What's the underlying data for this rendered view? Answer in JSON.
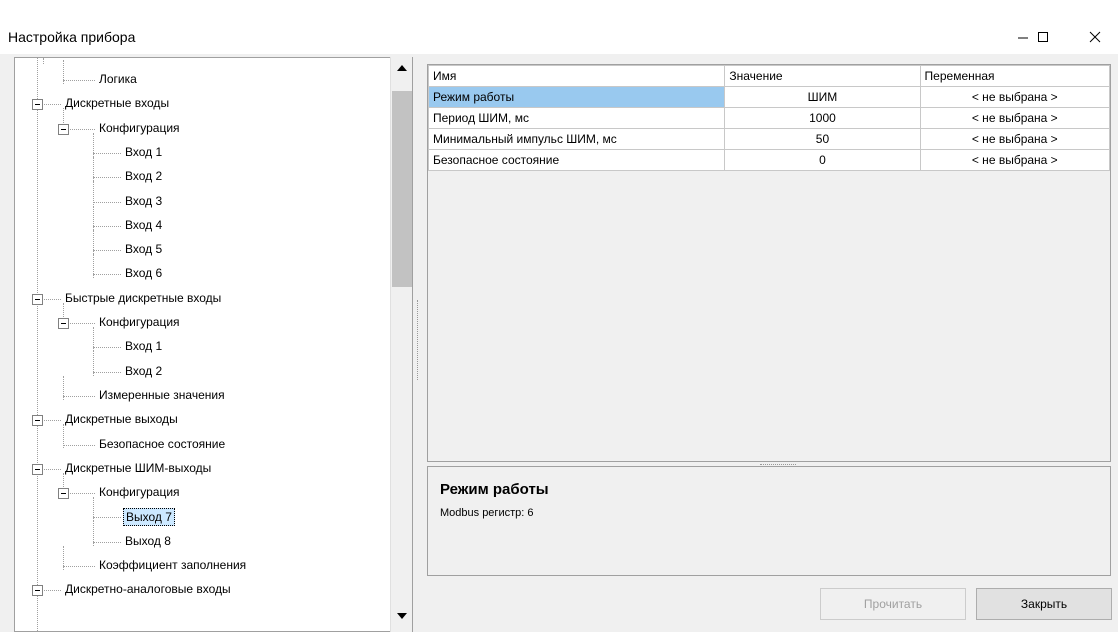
{
  "window": {
    "title": "Настройка прибора",
    "controls": {
      "minimize": "minimize-icon",
      "maximize": "maximize-icon",
      "close": "close-icon"
    }
  },
  "tree": {
    "items": [
      {
        "label": "Логика",
        "level": 1,
        "expander": false
      },
      {
        "label": "Дискретные входы",
        "level": 0,
        "expander": true
      },
      {
        "label": "Конфигурация",
        "level": 1,
        "expander": true
      },
      {
        "label": "Вход 1",
        "level": 2,
        "expander": false
      },
      {
        "label": "Вход 2",
        "level": 2,
        "expander": false
      },
      {
        "label": "Вход 3",
        "level": 2,
        "expander": false
      },
      {
        "label": "Вход 4",
        "level": 2,
        "expander": false
      },
      {
        "label": "Вход 5",
        "level": 2,
        "expander": false
      },
      {
        "label": "Вход 6",
        "level": 2,
        "expander": false
      },
      {
        "label": "Быстрые дискретные входы",
        "level": 0,
        "expander": true
      },
      {
        "label": "Конфигурация",
        "level": 1,
        "expander": true
      },
      {
        "label": "Вход 1",
        "level": 2,
        "expander": false
      },
      {
        "label": "Вход 2",
        "level": 2,
        "expander": false
      },
      {
        "label": "Измеренные значения",
        "level": 1,
        "expander": false
      },
      {
        "label": "Дискретные выходы",
        "level": 0,
        "expander": true
      },
      {
        "label": "Безопасное состояние",
        "level": 1,
        "expander": false
      },
      {
        "label": "Дискретные ШИМ-выходы",
        "level": 0,
        "expander": true
      },
      {
        "label": "Конфигурация",
        "level": 1,
        "expander": true
      },
      {
        "label": "Выход 7",
        "level": 2,
        "expander": false,
        "selected": true
      },
      {
        "label": "Выход 8",
        "level": 2,
        "expander": false
      },
      {
        "label": "Коэффициент заполнения",
        "level": 1,
        "expander": false
      },
      {
        "label": "Дискретно-аналоговые входы",
        "level": 0,
        "expander": true
      }
    ]
  },
  "grid": {
    "headers": {
      "name": "Имя",
      "value": "Значение",
      "variable": "Переменная"
    },
    "rows": [
      {
        "name": "Режим работы",
        "value": "ШИМ",
        "variable": "< не выбрана >",
        "selected": true
      },
      {
        "name": "Период ШИМ, мс",
        "value": "1000",
        "variable": "< не выбрана >"
      },
      {
        "name": "Минимальный импульс ШИМ, мс",
        "value": "50",
        "variable": "< не выбрана >"
      },
      {
        "name": "Безопасное состояние",
        "value": "0",
        "variable": "< не выбрана >"
      }
    ]
  },
  "description": {
    "title": "Режим работы",
    "text": "Modbus регистр: 6"
  },
  "buttons": {
    "read": "Прочитать",
    "close": "Закрыть"
  },
  "colors": {
    "selection": "#99c9ef",
    "tree_selection": "#cce8ff"
  }
}
